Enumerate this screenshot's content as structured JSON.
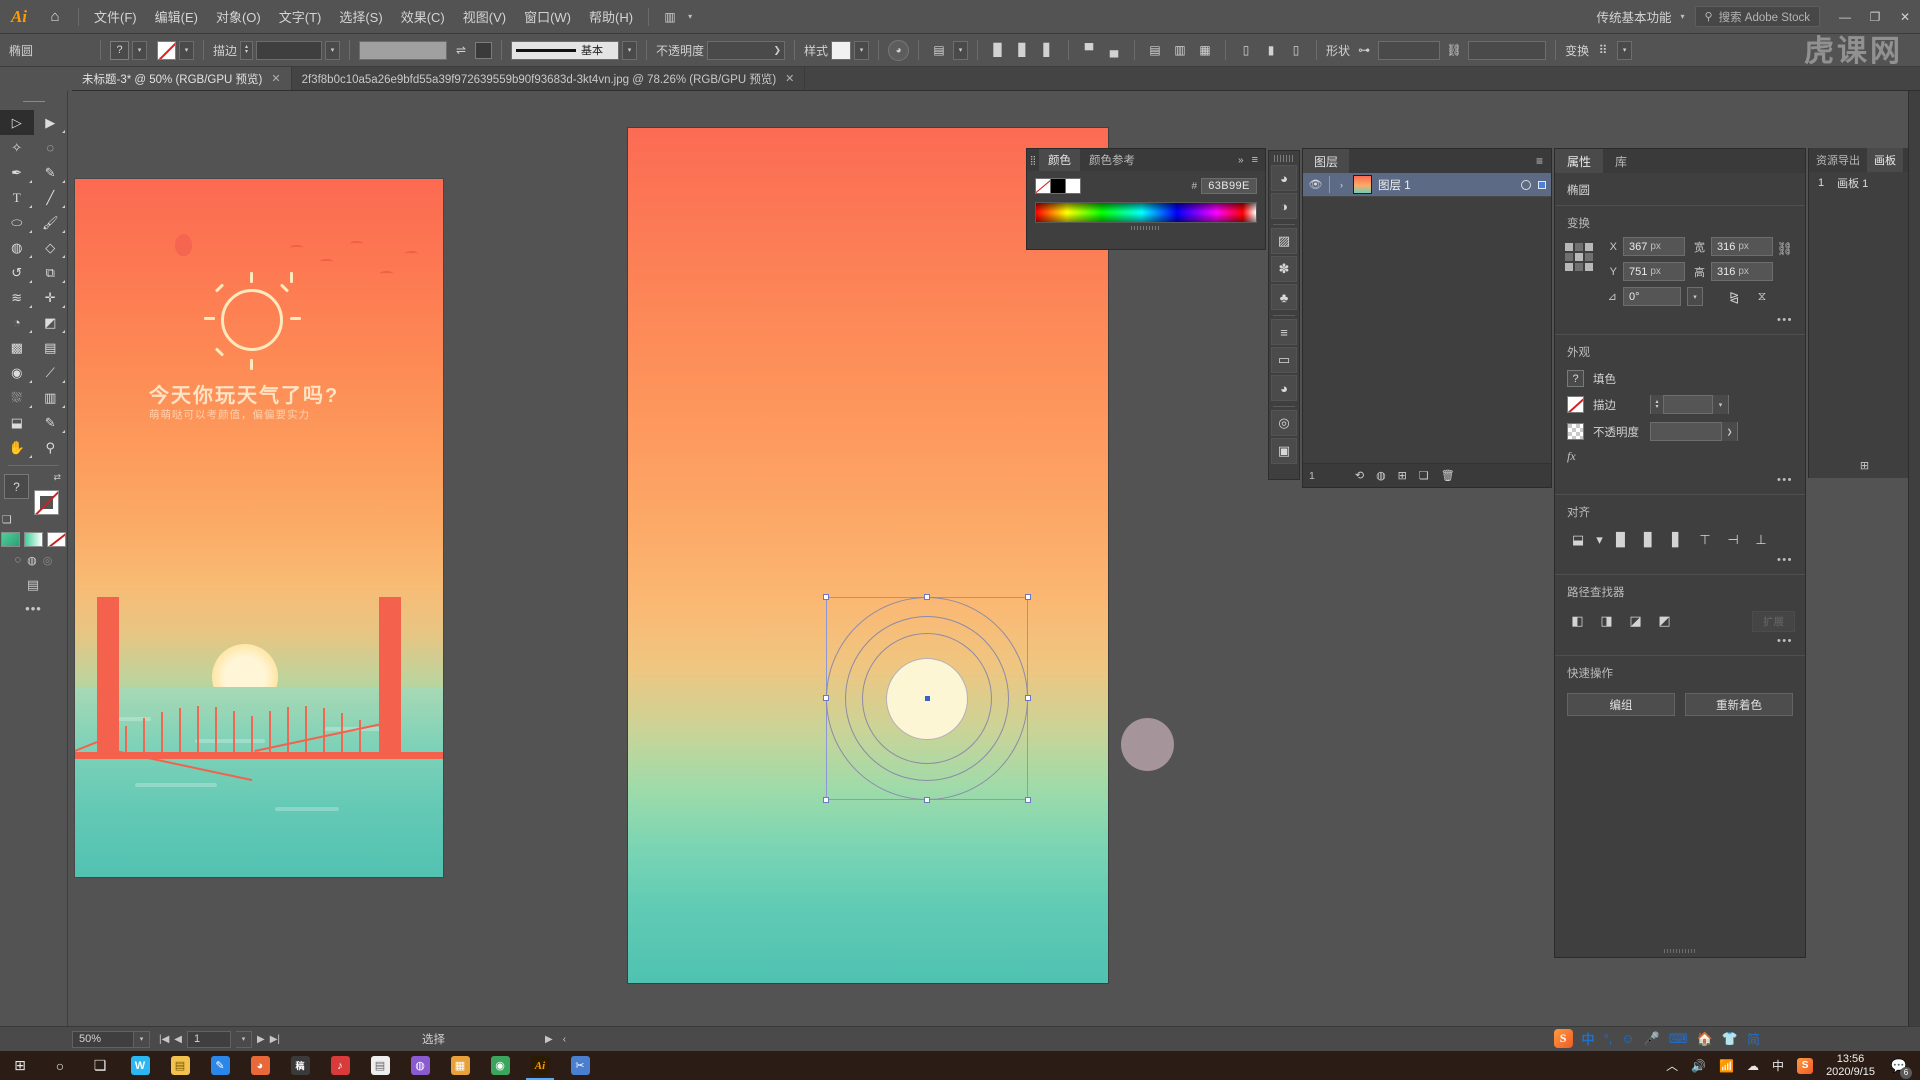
{
  "app": {
    "name": "Adobe Illustrator",
    "logo": "Ai",
    "home_icon": "home-icon"
  },
  "menubar": {
    "items": [
      {
        "label": "文件(F)"
      },
      {
        "label": "编辑(E)"
      },
      {
        "label": "对象(O)"
      },
      {
        "label": "文字(T)"
      },
      {
        "label": "选择(S)"
      },
      {
        "label": "效果(C)"
      },
      {
        "label": "视图(V)"
      },
      {
        "label": "窗口(W)"
      },
      {
        "label": "帮助(H)"
      }
    ],
    "workspace": "传统基本功能",
    "search_placeholder": "搜索 Adobe Stock",
    "window_buttons": {
      "minimize": "—",
      "restore": "❐",
      "close": "✕"
    }
  },
  "watermark": {
    "chars": [
      "虎",
      "课",
      "网"
    ]
  },
  "controlbar": {
    "object_type": "椭圆",
    "fill_label": "?",
    "stroke_label": "描边",
    "stroke_weight": "",
    "brush_label": "基本",
    "opacity_label": "不透明度",
    "opacity_value": "",
    "style_label": "样式",
    "transform_label": "变换",
    "shape_label": "形状"
  },
  "tabs": [
    {
      "title": "未标题-3* @ 50% (RGB/GPU 预览)",
      "active": true,
      "close": "✕"
    },
    {
      "title": "2f3f8b0c10a5a26e9bfd55a39f972639559b90f93683d-3kt4vn.jpg @ 78.26% (RGB/GPU 预览)",
      "active": false,
      "close": "✕"
    }
  ],
  "toolbar": {
    "tools": [
      {
        "name": "selection-tool",
        "glyph": "▷",
        "selected": true
      },
      {
        "name": "direct-selection-tool",
        "glyph": "▶",
        "selected": false
      },
      {
        "name": "magic-wand-tool",
        "glyph": "✨",
        "selected": false
      },
      {
        "name": "lasso-tool",
        "glyph": "◌",
        "selected": false
      },
      {
        "name": "pen-tool",
        "glyph": "✒",
        "selected": false
      },
      {
        "name": "curvature-tool",
        "glyph": "✎",
        "selected": false
      },
      {
        "name": "type-tool",
        "glyph": "T",
        "selected": false
      },
      {
        "name": "line-segment-tool",
        "glyph": "╱",
        "selected": false
      },
      {
        "name": "ellipse-tool",
        "glyph": "⬭",
        "selected": false
      },
      {
        "name": "paintbrush-tool",
        "glyph": "🖌",
        "selected": false
      },
      {
        "name": "shaper-tool",
        "glyph": "◍",
        "selected": false
      },
      {
        "name": "eraser-tool",
        "glyph": "◇",
        "selected": false
      },
      {
        "name": "rotate-tool",
        "glyph": "↺",
        "selected": false
      },
      {
        "name": "scale-tool",
        "glyph": "⧉",
        "selected": false
      },
      {
        "name": "width-tool",
        "glyph": "≈",
        "selected": false
      },
      {
        "name": "free-transform-tool",
        "glyph": "✛",
        "selected": false
      },
      {
        "name": "shape-builder-tool",
        "glyph": "◔",
        "selected": false
      },
      {
        "name": "perspective-grid-tool",
        "glyph": "◩",
        "selected": false
      },
      {
        "name": "mesh-tool",
        "glyph": "▩",
        "selected": false
      },
      {
        "name": "gradient-tool",
        "glyph": "▤",
        "selected": false
      },
      {
        "name": "blend-tool",
        "glyph": "◉",
        "selected": false
      },
      {
        "name": "eyedropper-tool",
        "glyph": "⟋",
        "selected": false
      },
      {
        "name": "symbol-sprayer-tool",
        "glyph": "⛆",
        "selected": false
      },
      {
        "name": "column-graph-tool",
        "glyph": "▥",
        "selected": false
      },
      {
        "name": "artboard-tool",
        "glyph": "⬒",
        "selected": false
      },
      {
        "name": "slice-tool",
        "glyph": "✂",
        "selected": false
      },
      {
        "name": "hand-tool",
        "glyph": "✋",
        "selected": false
      },
      {
        "name": "zoom-tool",
        "glyph": "⚲",
        "selected": false
      }
    ],
    "fill_stroke": {
      "fill_label": "?",
      "swap": "⇄"
    },
    "color_modes": [
      "gradient-swatch",
      "gradient-mode",
      "none-mode"
    ],
    "screen_modes": [
      "normal-screen-mode",
      "full-screen-mode"
    ],
    "more": "•••"
  },
  "artwork_left": {
    "title": "今天你玩天气了吗?",
    "subtitle": "萌萌哒可以考颜值，偏偏要实力"
  },
  "color_panel": {
    "tabs": [
      {
        "label": "颜色",
        "active": true
      },
      {
        "label": "颜色参考",
        "active": false
      }
    ],
    "hash_label": "#",
    "hex_value": "63B99E",
    "swatches": [
      "none",
      "black",
      "white"
    ],
    "chevrons": "»",
    "menu": "≡"
  },
  "mini_dock": {
    "icons": [
      {
        "name": "swatches-icon",
        "glyph": "🎨"
      },
      {
        "name": "gradient-icon",
        "glyph": "◔"
      },
      {
        "name": "transparency-icon",
        "glyph": "▨"
      },
      {
        "name": "brushes-icon",
        "glyph": "✽"
      },
      {
        "name": "symbols-icon",
        "glyph": "♣"
      },
      {
        "name": "stroke-icon",
        "glyph": "≡"
      },
      {
        "name": "appearance-icon",
        "glyph": "▭"
      },
      {
        "name": "graphic-styles-icon",
        "glyph": "◕"
      },
      {
        "name": "asset-export-icon",
        "glyph": "◎"
      },
      {
        "name": "artboards-icon",
        "glyph": "▣"
      }
    ]
  },
  "layers_panel": {
    "tab": "图层",
    "menu": "≡",
    "rows": [
      {
        "name": "图层 1",
        "visible": true,
        "selected": true,
        "expand": "›"
      }
    ],
    "footer": {
      "count": "1",
      "buttons": [
        "locate-object",
        "make-clipping-mask",
        "create-new-sublayer",
        "create-new-layer",
        "delete-selection"
      ]
    }
  },
  "properties_panel": {
    "tabs": [
      {
        "label": "属性",
        "active": true
      },
      {
        "label": "库",
        "active": false
      }
    ],
    "object_type": "椭圆",
    "transform": {
      "title": "变换",
      "x_label": "X",
      "x_value": "367",
      "y_label": "Y",
      "y_value": "751",
      "w_label": "宽",
      "w_value": "316",
      "h_label": "高",
      "h_value": "316",
      "unit": "px",
      "angle_label": "⊿",
      "angle_value": "0°",
      "more": "•••"
    },
    "appearance": {
      "title": "外观",
      "fill_label": "填色",
      "fill_swatch": "?",
      "stroke_label": "描边",
      "stroke_value": "",
      "opacity_label": "不透明度",
      "opacity_value": "",
      "fx_label": "fx"
    },
    "align": {
      "title": "对齐",
      "more": "•••"
    },
    "pathfinder": {
      "title": "路径查找器",
      "expand_label": "扩展"
    },
    "quick_actions": {
      "title": "快速操作",
      "buttons": [
        {
          "label": "编组"
        },
        {
          "label": "重新着色"
        }
      ]
    }
  },
  "artboard_panel": {
    "tabs": [
      {
        "label": "资源导出",
        "active": false
      },
      {
        "label": "画板",
        "active": true
      }
    ],
    "rows": [
      {
        "index": "1",
        "name": "画板 1"
      }
    ],
    "footer": "⊞"
  },
  "statusbar": {
    "zoom": "50%",
    "page": "1",
    "status_text": "选择",
    "nav": {
      "first": "|◀",
      "prev": "◀",
      "next": "▶",
      "last": "▶|"
    },
    "arrows": {
      "right": "▶",
      "left": "‹"
    }
  },
  "ime": {
    "logo": "S",
    "mode": "中",
    "items": [
      "°,",
      "☺",
      "🎤",
      "⌨",
      "🏠",
      "👕",
      "简"
    ]
  },
  "taskbar": {
    "start": "⊞",
    "search": "○",
    "taskview": "❏",
    "apps": [
      {
        "name": "app-wechat",
        "glyph": "W",
        "color": "#2bb7f1",
        "active": false
      },
      {
        "name": "app-explorer",
        "glyph": "📁",
        "color": "#f2c14e",
        "active": false
      },
      {
        "name": "app-editor",
        "glyph": "✎",
        "color": "#2a86e8",
        "active": false
      },
      {
        "name": "app-firefox",
        "glyph": "🦊",
        "color": "#e8683a",
        "active": false
      },
      {
        "name": "app-gao",
        "glyph": "稿",
        "color": "#3a3a3a",
        "active": false
      },
      {
        "name": "app-netease",
        "glyph": "♪",
        "color": "#d93b3b",
        "active": false
      },
      {
        "name": "app-notes",
        "glyph": "▤",
        "color": "#e8e8e8",
        "active": false
      },
      {
        "name": "app-photos",
        "glyph": "◍",
        "color": "#8a5ad0",
        "active": false
      },
      {
        "name": "app-media",
        "glyph": "▦",
        "color": "#e8a13a",
        "active": false
      },
      {
        "name": "app-chrome",
        "glyph": "◉",
        "color": "#3ba55d",
        "active": false
      },
      {
        "name": "app-illustrator",
        "glyph": "Ai",
        "color": "#2b1b00",
        "active": true
      },
      {
        "name": "app-snipaste",
        "glyph": "✂",
        "color": "#4a7fd0",
        "active": false
      }
    ],
    "tray": {
      "chevron": "︿",
      "volume": "🔊",
      "network": "📶",
      "onedrive": "☁",
      "ime_mode": "中",
      "sogou": "S",
      "time": "13:56",
      "date": "2020/9/15",
      "notifications": "💬",
      "notification_count": "6"
    }
  }
}
